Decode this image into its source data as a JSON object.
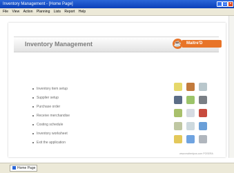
{
  "window": {
    "title": "Inventory Management - [Home Page]",
    "controls": {
      "minimize": "_",
      "maximize": "□",
      "close": "×"
    }
  },
  "menu": {
    "items": [
      "File",
      "View",
      "Action",
      "Planning",
      "Lists",
      "Report",
      "Help"
    ]
  },
  "header": {
    "title": "Inventory Management",
    "logo_text": "Maitre'D",
    "logo_glyph": "☕"
  },
  "nav": {
    "items": [
      "Inventory item setup",
      "Supplier setup",
      "Purchase order",
      "Receive merchandise",
      "Costing schedule",
      "Inventory worksheet",
      "Exit the application"
    ]
  },
  "footer": {
    "text": "www.maitredpos.com  POSERA"
  },
  "taskbar": {
    "tab_label": "Home Page"
  },
  "colors": {
    "accent": "#e87428",
    "title_bar": "#0a3fb8"
  }
}
